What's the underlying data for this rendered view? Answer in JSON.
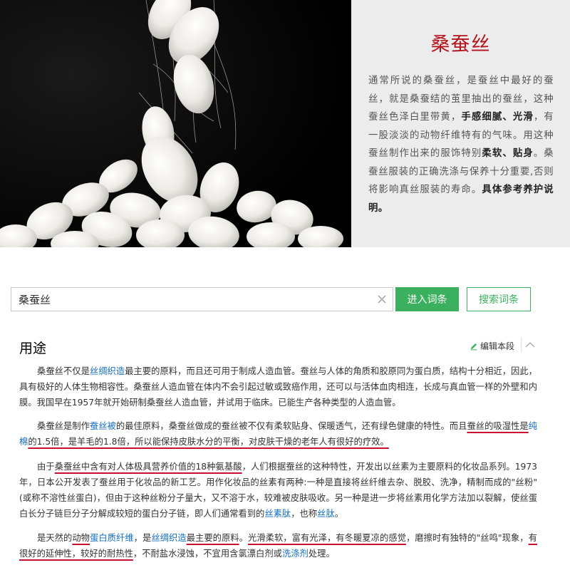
{
  "banner": {
    "title": "桑蚕丝",
    "desc": [
      {
        "t": "通常所说的桑蚕丝，是蚕丝中最好的蚕丝，就是桑蚕结的茧里抽出的蚕丝，这种蚕丝色泽白里带黄，"
      },
      {
        "t": "手感细腻、光滑",
        "b": true
      },
      {
        "t": "，有一股淡淡的动物纤维特有的气味。用这种蚕丝制作出来的服饰特别"
      },
      {
        "t": "柔软、贴身",
        "b": true
      },
      {
        "t": "。桑蚕丝服装的正确洗涤与保养十分重要,否则将影响真丝服装的寿命。"
      },
      {
        "t": "具体参考养护说明。",
        "b": true
      }
    ]
  },
  "search": {
    "value": "桑蚕丝",
    "enter_label": "进入词条",
    "search_label": "搜索词条"
  },
  "section": {
    "title": "用途",
    "edit_label": "编辑本段"
  },
  "colors": {
    "accent_green": "#3bb15f",
    "title_red": "#b3141b",
    "link_blue": "#136ec2",
    "underline_red": "#c8102e"
  },
  "paragraphs": [
    [
      {
        "t": "桑蚕丝不仅是"
      },
      {
        "t": "丝绸织造",
        "link": true
      },
      {
        "t": "最主要的原料，而且还可用于制成人造血管。蚕丝与人体的角质和胶原同为蛋白质，结构十分相近，因此，具有极好的人体生物相容性。桑蚕丝人造血管在体内不会引起过敏或致癌作用，还可以与活体血肉相连，长成与真血管一样的外壁和内膜。我国早在1957年就开始研制桑蚕丝人造血管，并试用于临床。已能生产各种类型的人造血管。"
      }
    ],
    [
      {
        "t": "桑蚕丝是制作"
      },
      {
        "t": "蚕丝被",
        "link": true
      },
      {
        "t": "的最佳原料，桑蚕丝做成的蚕丝被不仅有柔软贴身、保暖透气，还有绿色健康的特性。而且"
      },
      {
        "t": "蚕丝的吸湿性是",
        "ul": true
      },
      {
        "t": "纯棉",
        "link": true,
        "ul": true
      },
      {
        "t": "的1.5倍，是羊毛的1.8倍，所以能保持皮肤水分的平衡，对皮肤干燥的老年人有很好的疗效。",
        "ul": true
      }
    ],
    [
      {
        "t": "由于"
      },
      {
        "t": "桑蚕丝中含有对人体极具营养价值的18种氨基酸",
        "ul": true
      },
      {
        "t": "，人们根据蚕丝的这种特性，开发出以丝素为主要原料的化妆品系列。1973年，日本公开发表了蚕丝用于化妆品的新工艺。用作化妆品的丝素有两种:一种是直接将丝纤维去杂、脱胶、洗净，精制而成的\"丝粉\"(或称不溶性丝蛋白)，但由于这种丝粉分子量大，又不溶于水，较难被皮肤吸收。另一种是进一步将丝素用化学方法加以裂解，使丝蛋白长分子链巨分子分解成较短的蛋白分子链，即人们通常看到的"
      },
      {
        "t": "丝素肽",
        "link": true
      },
      {
        "t": "，也称"
      },
      {
        "t": "丝肽",
        "link": true
      },
      {
        "t": "。"
      }
    ],
    [
      {
        "t": "是天然的"
      },
      {
        "t": "动物",
        "ul": true
      },
      {
        "t": "蛋白质纤维",
        "link": true,
        "ul": true
      },
      {
        "t": "，是"
      },
      {
        "t": "丝绸织造",
        "link": true,
        "ul": true
      },
      {
        "t": "最主要的原料",
        "ul": true
      },
      {
        "t": "。"
      },
      {
        "t": "光滑柔软，富有光泽，有冬暖夏凉的感觉",
        "ul": true
      },
      {
        "t": "，磨擦时有独特的\"丝鸣\"现象，"
      },
      {
        "t": "有很好的延伸性，较好的耐热性",
        "ul": true
      },
      {
        "t": "，不耐盐水浸蚀，不宜用含氯漂白剂或"
      },
      {
        "t": "洗涤剂",
        "link": true
      },
      {
        "t": "处理。"
      }
    ]
  ]
}
